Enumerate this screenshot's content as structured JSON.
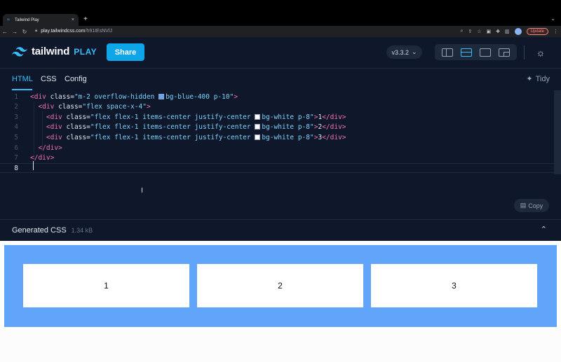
{
  "browser": {
    "tab_title": "Tailwind Play",
    "tab_close": "×",
    "new_tab": "+",
    "tab_menu": "⌄",
    "nav": {
      "back": "←",
      "forward": "→",
      "reload": "↻"
    },
    "url_host": "play.tailwindcss.com",
    "url_path": "/h91IEsNVlJ",
    "lock": "🔒",
    "update_label": "Update"
  },
  "app": {
    "logo_word": "tailwind",
    "logo_play": "PLAY",
    "share_label": "Share",
    "version_label": "v3.3.2",
    "version_chevron": "⌄",
    "theme_icon": "☼",
    "tabs": [
      {
        "label": "HTML",
        "active": true
      },
      {
        "label": "CSS",
        "active": false
      },
      {
        "label": "Config",
        "active": false
      }
    ],
    "tidy_label": "Tidy",
    "tidy_icon": "✦",
    "copy_label": "Copy",
    "copy_icon": "▤",
    "cursor_icon": "I"
  },
  "editor": {
    "lines": [
      {
        "num": "1",
        "indent": "",
        "open": "<div",
        "attr": " class=",
        "q1": "\"",
        "cls_pre": "m-2 overflow-hidden ",
        "swatch": "#60a5fa",
        "cls_post": "bg-blue-400 p-10",
        "q2": "\"",
        "close": ">",
        "text": "",
        "end": ""
      },
      {
        "num": "2",
        "indent": "  ",
        "open": "<div",
        "attr": " class=",
        "q1": "\"",
        "cls_pre": "flex space-x-4",
        "swatch": "",
        "cls_post": "",
        "q2": "\"",
        "close": ">",
        "text": "",
        "end": ""
      },
      {
        "num": "3",
        "indent": "    ",
        "open": "<div",
        "attr": " class=",
        "q1": "\"",
        "cls_pre": "flex flex-1 items-center justify-center ",
        "swatch": "#ffffff",
        "cls_post": "bg-white p-8",
        "q2": "\"",
        "close": ">",
        "text": "1",
        "end": "</div>"
      },
      {
        "num": "4",
        "indent": "    ",
        "open": "<div",
        "attr": " class=",
        "q1": "\"",
        "cls_pre": "flex flex-1 items-center justify-center ",
        "swatch": "#ffffff",
        "cls_post": "bg-white p-8",
        "q2": "\"",
        "close": ">",
        "text": "2",
        "end": "</div>"
      },
      {
        "num": "5",
        "indent": "    ",
        "open": "<div",
        "attr": " class=",
        "q1": "\"",
        "cls_pre": "flex flex-1 items-center justify-center ",
        "swatch": "#ffffff",
        "cls_post": "bg-white p-8",
        "q2": "\"",
        "close": ">",
        "text": "3",
        "end": "</div>"
      },
      {
        "num": "6",
        "indent": "  ",
        "open": "</div>",
        "attr": "",
        "q1": "",
        "cls_pre": "",
        "swatch": "",
        "cls_post": "",
        "q2": "",
        "close": "",
        "text": "",
        "end": ""
      },
      {
        "num": "7",
        "indent": "",
        "open": "</div>",
        "attr": "",
        "q1": "",
        "cls_pre": "",
        "swatch": "",
        "cls_post": "",
        "q2": "",
        "close": "",
        "text": "",
        "end": ""
      },
      {
        "num": "8",
        "indent": "",
        "open": "",
        "attr": "",
        "q1": "",
        "cls_pre": "",
        "swatch": "",
        "cls_post": "",
        "q2": "",
        "close": "",
        "text": "",
        "end": ""
      }
    ]
  },
  "generated_css": {
    "title": "Generated CSS",
    "size": "1.34 kB",
    "chevron": "⌃"
  },
  "preview": {
    "container_color": "#60a5fa",
    "items": [
      "1",
      "2",
      "3"
    ]
  }
}
